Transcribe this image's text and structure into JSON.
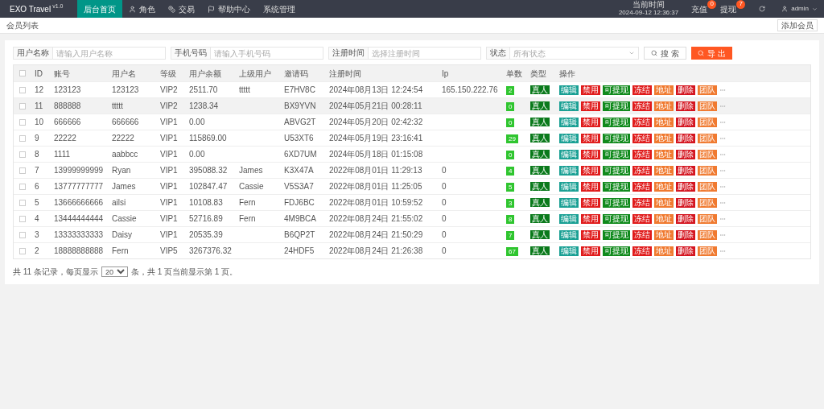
{
  "header": {
    "logo": "EXO Travel",
    "version": "v1.0",
    "nav": [
      {
        "label": "后台首页",
        "selected": true
      },
      {
        "label": "角色",
        "selected": false
      },
      {
        "label": "交易",
        "selected": false
      },
      {
        "label": "帮助中心",
        "selected": false
      },
      {
        "label": "系统管理",
        "selected": false
      }
    ],
    "clock_label": "当前时间",
    "clock": "2024-09-12 12:36:37",
    "alerts": [
      {
        "label": "充值",
        "count": "0"
      },
      {
        "label": "提现",
        "count": "7"
      }
    ],
    "user": "admin"
  },
  "breadcrumb": "会员列表",
  "add_button": "添加会员",
  "filters": [
    {
      "kind": "text",
      "label": "用户名称",
      "placeholder": "请输入用户名称"
    },
    {
      "kind": "text",
      "label": "手机号码",
      "placeholder": "请输入手机号码"
    },
    {
      "kind": "text",
      "label": "注册时间",
      "placeholder": "选择注册时间"
    },
    {
      "kind": "select",
      "label": "状态",
      "placeholder": "所有状态"
    }
  ],
  "search_button": "搜 索",
  "export_button": "导 出",
  "table": {
    "all_checked": false,
    "columns": [
      "ID",
      "账号",
      "用户名",
      "等级",
      "用户余额",
      "上级用户",
      "邀请码",
      "注册时间",
      "Ip",
      "单数",
      "类型",
      "操作"
    ],
    "rows": [
      {
        "selected": false,
        "checked": false,
        "cells": [
          "12",
          "123123",
          "123123",
          "VIP2",
          "2511.70",
          "ttttt",
          "E7HV8C",
          "2024年08月13日 12:24:54",
          "165.150.222.76"
        ],
        "count": "2",
        "type": "真人",
        "actions": [
          {
            "label": "编辑",
            "color": "#1aa094"
          },
          {
            "label": "禁用",
            "color": "#e01b1b"
          },
          {
            "label": "可提现",
            "color": "#108a1c"
          },
          {
            "label": "冻结",
            "color": "#e01b1b"
          },
          {
            "label": "地址",
            "color": "#f07a30"
          },
          {
            "label": "删除",
            "color": "#d4141f"
          },
          {
            "label": "团队",
            "color": "#f07a30"
          }
        ]
      },
      {
        "selected": true,
        "checked": false,
        "cells": [
          "11",
          "888888",
          "ttttt",
          "VIP2",
          "1238.34",
          "",
          "BX9YVN",
          "2024年05月21日 00:28:11",
          ""
        ],
        "count": "0",
        "type": "真人",
        "actions": [
          {
            "label": "编辑",
            "color": "#1aa094"
          },
          {
            "label": "禁用",
            "color": "#e01b1b"
          },
          {
            "label": "可提现",
            "color": "#108a1c"
          },
          {
            "label": "冻结",
            "color": "#e01b1b"
          },
          {
            "label": "地址",
            "color": "#f07a30"
          },
          {
            "label": "删除",
            "color": "#d4141f"
          },
          {
            "label": "团队",
            "color": "#f07a30"
          }
        ]
      },
      {
        "selected": false,
        "checked": false,
        "cells": [
          "10",
          "666666",
          "666666",
          "VIP1",
          "0.00",
          "",
          "ABVG2T",
          "2024年05月20日 02:42:32",
          ""
        ],
        "count": "0",
        "type": "真人",
        "actions": [
          {
            "label": "编辑",
            "color": "#1aa094"
          },
          {
            "label": "禁用",
            "color": "#e01b1b"
          },
          {
            "label": "可提现",
            "color": "#108a1c"
          },
          {
            "label": "冻结",
            "color": "#e01b1b"
          },
          {
            "label": "地址",
            "color": "#f07a30"
          },
          {
            "label": "删除",
            "color": "#d4141f"
          },
          {
            "label": "团队",
            "color": "#f07a30"
          }
        ]
      },
      {
        "selected": false,
        "checked": false,
        "cells": [
          "9",
          "22222",
          "22222",
          "VIP1",
          "115869.00",
          "",
          "U53XT6",
          "2024年05月19日 23:16:41",
          ""
        ],
        "count": "29",
        "type": "真人",
        "actions": [
          {
            "label": "编辑",
            "color": "#1aa094"
          },
          {
            "label": "禁用",
            "color": "#e01b1b"
          },
          {
            "label": "可提现",
            "color": "#108a1c"
          },
          {
            "label": "冻结",
            "color": "#e01b1b"
          },
          {
            "label": "地址",
            "color": "#f07a30"
          },
          {
            "label": "删除",
            "color": "#d4141f"
          },
          {
            "label": "团队",
            "color": "#f07a30"
          }
        ]
      },
      {
        "selected": false,
        "checked": false,
        "cells": [
          "8",
          "1111",
          "aabbcc",
          "VIP1",
          "0.00",
          "",
          "6XD7UM",
          "2024年05月18日 01:15:08",
          ""
        ],
        "count": "0",
        "type": "真人",
        "actions": [
          {
            "label": "编辑",
            "color": "#1aa094"
          },
          {
            "label": "禁用",
            "color": "#e01b1b"
          },
          {
            "label": "可提现",
            "color": "#108a1c"
          },
          {
            "label": "冻结",
            "color": "#e01b1b"
          },
          {
            "label": "地址",
            "color": "#f07a30"
          },
          {
            "label": "删除",
            "color": "#d4141f"
          },
          {
            "label": "团队",
            "color": "#f07a30"
          }
        ]
      },
      {
        "selected": false,
        "checked": false,
        "cells": [
          "7",
          "13999999999",
          "Ryan",
          "VIP1",
          "395088.32",
          "James",
          "K3X47A",
          "2022年08月01日 11:29:13",
          "0"
        ],
        "count": "4",
        "type": "真人",
        "actions": [
          {
            "label": "编辑",
            "color": "#1aa094"
          },
          {
            "label": "禁用",
            "color": "#e01b1b"
          },
          {
            "label": "可提现",
            "color": "#108a1c"
          },
          {
            "label": "冻结",
            "color": "#e01b1b"
          },
          {
            "label": "地址",
            "color": "#f07a30"
          },
          {
            "label": "删除",
            "color": "#d4141f"
          },
          {
            "label": "团队",
            "color": "#f07a30"
          }
        ]
      },
      {
        "selected": false,
        "checked": false,
        "cells": [
          "6",
          "13777777777",
          "James",
          "VIP1",
          "102847.47",
          "Cassie",
          "V5S3A7",
          "2022年08月01日 11:25:05",
          "0"
        ],
        "count": "5",
        "type": "真人",
        "actions": [
          {
            "label": "编辑",
            "color": "#1aa094"
          },
          {
            "label": "禁用",
            "color": "#e01b1b"
          },
          {
            "label": "可提现",
            "color": "#108a1c"
          },
          {
            "label": "冻结",
            "color": "#e01b1b"
          },
          {
            "label": "地址",
            "color": "#f07a30"
          },
          {
            "label": "删除",
            "color": "#d4141f"
          },
          {
            "label": "团队",
            "color": "#f07a30"
          }
        ]
      },
      {
        "selected": false,
        "checked": false,
        "cells": [
          "5",
          "13666666666",
          "ailsi",
          "VIP1",
          "10108.83",
          "Fern",
          "FDJ6BC",
          "2022年08月01日 10:59:52",
          "0"
        ],
        "count": "3",
        "type": "真人",
        "actions": [
          {
            "label": "编辑",
            "color": "#1aa094"
          },
          {
            "label": "禁用",
            "color": "#e01b1b"
          },
          {
            "label": "可提现",
            "color": "#108a1c"
          },
          {
            "label": "冻结",
            "color": "#e01b1b"
          },
          {
            "label": "地址",
            "color": "#f07a30"
          },
          {
            "label": "删除",
            "color": "#d4141f"
          },
          {
            "label": "团队",
            "color": "#f07a30"
          }
        ]
      },
      {
        "selected": false,
        "checked": false,
        "cells": [
          "4",
          "13444444444",
          "Cassie",
          "VIP1",
          "52716.89",
          "Fern",
          "4M9BCA",
          "2022年08月24日 21:55:02",
          "0"
        ],
        "count": "8",
        "type": "真人",
        "actions": [
          {
            "label": "编辑",
            "color": "#1aa094"
          },
          {
            "label": "禁用",
            "color": "#e01b1b"
          },
          {
            "label": "可提现",
            "color": "#108a1c"
          },
          {
            "label": "冻结",
            "color": "#e01b1b"
          },
          {
            "label": "地址",
            "color": "#f07a30"
          },
          {
            "label": "删除",
            "color": "#d4141f"
          },
          {
            "label": "团队",
            "color": "#f07a30"
          }
        ]
      },
      {
        "selected": false,
        "checked": false,
        "cells": [
          "3",
          "13333333333",
          "Daisy",
          "VIP1",
          "20535.39",
          "",
          "B6QP2T",
          "2022年08月24日 21:50:29",
          "0"
        ],
        "count": "7",
        "type": "真人",
        "actions": [
          {
            "label": "编辑",
            "color": "#1aa094"
          },
          {
            "label": "禁用",
            "color": "#e01b1b"
          },
          {
            "label": "可提现",
            "color": "#108a1c"
          },
          {
            "label": "冻结",
            "color": "#e01b1b"
          },
          {
            "label": "地址",
            "color": "#f07a30"
          },
          {
            "label": "删除",
            "color": "#d4141f"
          },
          {
            "label": "团队",
            "color": "#f07a30"
          }
        ]
      },
      {
        "selected": false,
        "checked": false,
        "cells": [
          "2",
          "18888888888",
          "Fern",
          "VIP5",
          "3267376.32",
          "",
          "24HDF5",
          "2022年08月24日 21:26:38",
          "0"
        ],
        "count": "67",
        "type": "真人",
        "actions": [
          {
            "label": "编辑",
            "color": "#1aa094"
          },
          {
            "label": "禁用",
            "color": "#e01b1b"
          },
          {
            "label": "可提现",
            "color": "#108a1c"
          },
          {
            "label": "冻结",
            "color": "#e01b1b"
          },
          {
            "label": "地址",
            "color": "#f07a30"
          },
          {
            "label": "删除",
            "color": "#d4141f"
          },
          {
            "label": "团队",
            "color": "#f07a30"
          }
        ]
      }
    ]
  },
  "pagination": {
    "before": "共 11 条记录，每页显示",
    "per_page": "20",
    "after": "条，共 1 页当前显示第 1 页。"
  }
}
